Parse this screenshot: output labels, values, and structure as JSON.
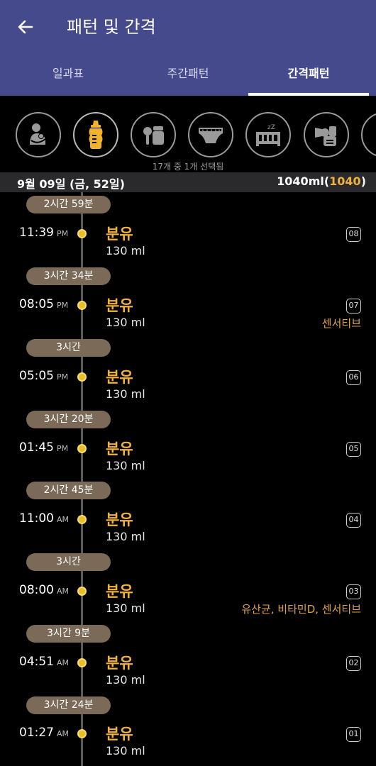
{
  "header": {
    "title": "패턴 및 간격",
    "back_icon": "arrow-left-icon",
    "background": "#454a8c"
  },
  "tabs": [
    {
      "label": "일과표",
      "active": false
    },
    {
      "label": "주간패턴",
      "active": false
    },
    {
      "label": "간격패턴",
      "active": true
    }
  ],
  "categories": [
    {
      "icon": "breastfeeding-icon"
    },
    {
      "icon": "baby-bottle-icon",
      "active": true
    },
    {
      "icon": "baby-food-icon"
    },
    {
      "icon": "diaper-icon"
    },
    {
      "icon": "sleep-crib-icon"
    },
    {
      "icon": "breast-pump-icon"
    },
    {
      "icon": "more-icon"
    }
  ],
  "selection_note": "17개 중 1개 선택됨",
  "date_bar": {
    "date": "9월 09일 (금, 52일)",
    "total": "1040ml(",
    "total_num": "1040",
    "total_close": ")"
  },
  "entries": [
    {
      "gap": "2시간 59분",
      "time": "11:39",
      "ampm": "PM",
      "name": "분유",
      "value": "130 ml",
      "num": "08",
      "note": ""
    },
    {
      "gap": "3시간 34분",
      "time": "08:05",
      "ampm": "PM",
      "name": "분유",
      "value": "130 ml",
      "num": "07",
      "note": "센서티브"
    },
    {
      "gap": "3시간",
      "time": "05:05",
      "ampm": "PM",
      "name": "분유",
      "value": "130 ml",
      "num": "06",
      "note": ""
    },
    {
      "gap": "3시간 20분",
      "time": "01:45",
      "ampm": "PM",
      "name": "분유",
      "value": "130 ml",
      "num": "05",
      "note": ""
    },
    {
      "gap": "2시간 45분",
      "time": "11:00",
      "ampm": "AM",
      "name": "분유",
      "value": "130 ml",
      "num": "04",
      "note": ""
    },
    {
      "gap": "3시간",
      "time": "08:00",
      "ampm": "AM",
      "name": "분유",
      "value": "130 ml",
      "num": "03",
      "note": "유산균, 비타민D, 센서티브"
    },
    {
      "gap": "3시간 9분",
      "time": "04:51",
      "ampm": "AM",
      "name": "분유",
      "value": "130 ml",
      "num": "02",
      "note": ""
    },
    {
      "gap": "3시간 24분",
      "time": "01:27",
      "ampm": "AM",
      "name": "분유",
      "value": "130 ml",
      "num": "01",
      "note": ""
    }
  ],
  "colors": {
    "accent": "#f1b23e",
    "gap_pill": "#7a6a57",
    "dot": "#e9bd2b"
  }
}
